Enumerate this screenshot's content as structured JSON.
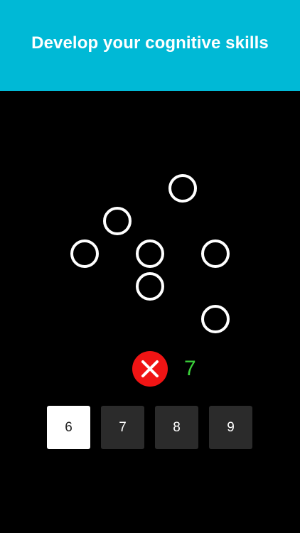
{
  "header": {
    "title": "Develop your cognitive skills",
    "background_color": "#00b9d6"
  },
  "game": {
    "circle_count": 7,
    "result": {
      "status": "wrong",
      "icon": "close-icon",
      "icon_color": "#f01414",
      "correct_answer": "7",
      "correct_answer_color": "#3bd23b"
    },
    "answers": [
      {
        "label": "6",
        "selected": true
      },
      {
        "label": "7",
        "selected": false
      },
      {
        "label": "8",
        "selected": false
      },
      {
        "label": "9",
        "selected": false
      }
    ]
  }
}
